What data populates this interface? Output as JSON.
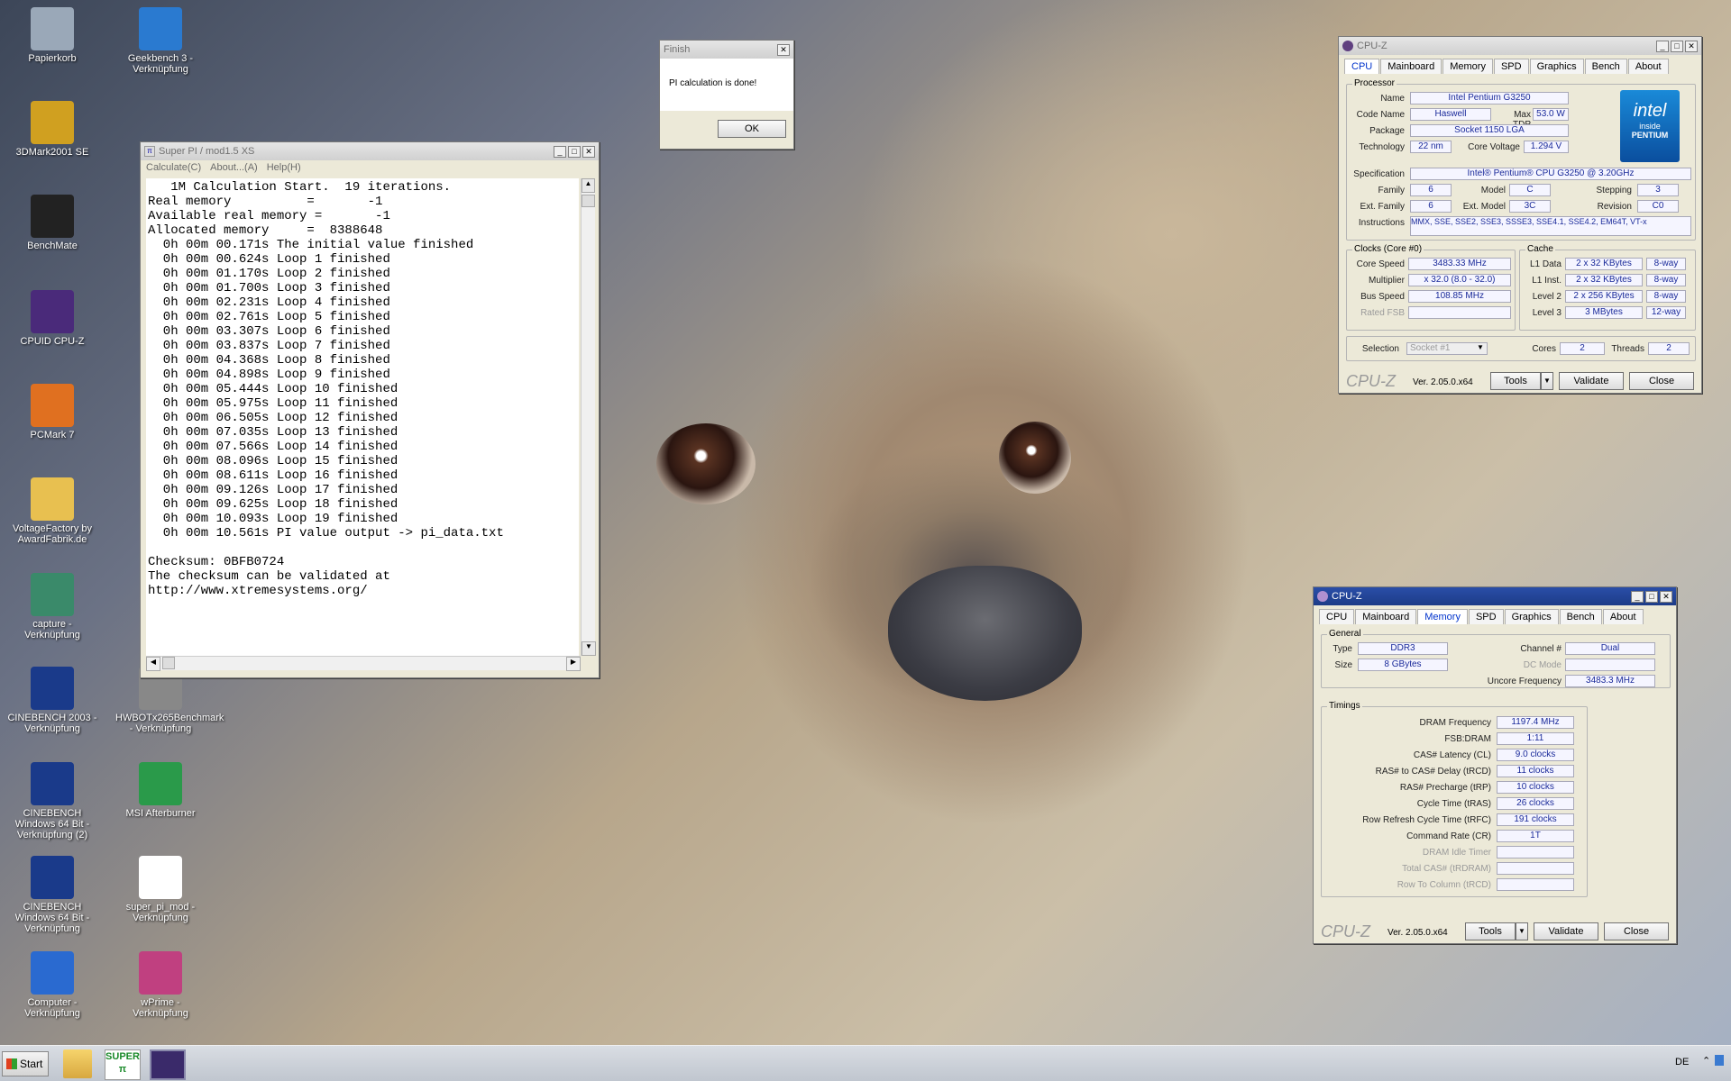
{
  "desktop_icons": [
    {
      "label": "Papierkorb",
      "icon": "recycle-bin-icon"
    },
    {
      "label": "Geekbench 3 - Verknüpfung",
      "icon": "geekbench-icon"
    },
    {
      "label": "3DMark2001 SE",
      "icon": "3dmark-icon"
    },
    {
      "label": "BenchMate",
      "icon": "benchmate-icon"
    },
    {
      "label": "CPUID CPU-Z",
      "icon": "cpuz-icon"
    },
    {
      "label": "PCMark 7",
      "icon": "pcmark-icon"
    },
    {
      "label": "VoltageFactory by AwardFabrik.de",
      "icon": "folder-icon"
    },
    {
      "label": "capture - Verknüpfung",
      "icon": "capture-icon"
    },
    {
      "label": "CINEBENCH 2003 - Verknüpfung",
      "icon": "cinebench-icon"
    },
    {
      "label": "HWBOTx265Benchmark - Verknüpfung",
      "icon": "hwbot-icon"
    },
    {
      "label": "CINEBENCH Windows 64 Bit - Verknüpfung (2)",
      "icon": "cinebench-icon"
    },
    {
      "label": "MSI Afterburner",
      "icon": "afterburner-icon"
    },
    {
      "label": "CINEBENCH Windows 64 Bit - Verknüpfung",
      "icon": "cinebench-icon"
    },
    {
      "label": "super_pi_mod - Verknüpfung",
      "icon": "superpi-icon"
    },
    {
      "label": "Computer - Verknüpfung",
      "icon": "computer-icon"
    },
    {
      "label": "wPrime - Verknüpfung",
      "icon": "wprime-icon"
    }
  ],
  "superpi": {
    "title": "Super PI / mod1.5 XS",
    "menu": [
      "Calculate(C)",
      "About...(A)",
      "Help(H)"
    ],
    "lines": [
      "   1M Calculation Start.  19 iterations.",
      "Real memory          =       -1",
      "Available real memory =       -1",
      "Allocated memory     =  8388648",
      "  0h 00m 00.171s The initial value finished",
      "  0h 00m 00.624s Loop 1 finished",
      "  0h 00m 01.170s Loop 2 finished",
      "  0h 00m 01.700s Loop 3 finished",
      "  0h 00m 02.231s Loop 4 finished",
      "  0h 00m 02.761s Loop 5 finished",
      "  0h 00m 03.307s Loop 6 finished",
      "  0h 00m 03.837s Loop 7 finished",
      "  0h 00m 04.368s Loop 8 finished",
      "  0h 00m 04.898s Loop 9 finished",
      "  0h 00m 05.444s Loop 10 finished",
      "  0h 00m 05.975s Loop 11 finished",
      "  0h 00m 06.505s Loop 12 finished",
      "  0h 00m 07.035s Loop 13 finished",
      "  0h 00m 07.566s Loop 14 finished",
      "  0h 00m 08.096s Loop 15 finished",
      "  0h 00m 08.611s Loop 16 finished",
      "  0h 00m 09.126s Loop 17 finished",
      "  0h 00m 09.625s Loop 18 finished",
      "  0h 00m 10.093s Loop 19 finished",
      "  0h 00m 10.561s PI value output -> pi_data.txt",
      "",
      "Checksum: 0BFB0724",
      "The checksum can be validated at",
      "http://www.xtremesystems.org/"
    ]
  },
  "finish_dialog": {
    "title": "Finish",
    "message": "PI calculation is done!",
    "ok": "OK"
  },
  "cpuz_tabs": [
    "CPU",
    "Mainboard",
    "Memory",
    "SPD",
    "Graphics",
    "Bench",
    "About"
  ],
  "cpuz_cpu": {
    "title": "CPU-Z",
    "processor_legend": "Processor",
    "name_label": "Name",
    "name": "Intel Pentium G3250",
    "codename_label": "Code Name",
    "codename": "Haswell",
    "maxtdp_label": "Max TDP",
    "maxtdp": "53.0 W",
    "package_label": "Package",
    "package": "Socket 1150 LGA",
    "technology_label": "Technology",
    "technology": "22 nm",
    "corevoltage_label": "Core Voltage",
    "corevoltage": "1.294 V",
    "spec_label": "Specification",
    "spec": "Intel® Pentium® CPU G3250 @ 3.20GHz",
    "family_label": "Family",
    "family": "6",
    "model_label": "Model",
    "model": "C",
    "stepping_label": "Stepping",
    "stepping": "3",
    "extfamily_label": "Ext. Family",
    "extfamily": "6",
    "extmodel_label": "Ext. Model",
    "extmodel": "3C",
    "revision_label": "Revision",
    "revision": "C0",
    "instructions_label": "Instructions",
    "instructions": "MMX, SSE, SSE2, SSE3, SSSE3, SSE4.1, SSE4.2, EM64T, VT-x",
    "clocks_legend": "Clocks (Core #0)",
    "corespeed_label": "Core Speed",
    "corespeed": "3483.33 MHz",
    "multiplier_label": "Multiplier",
    "multiplier": "x 32.0 (8.0 - 32.0)",
    "busspeed_label": "Bus Speed",
    "busspeed": "108.85 MHz",
    "ratedfsb_label": "Rated FSB",
    "ratedfsb": "",
    "cache_legend": "Cache",
    "l1data_label": "L1 Data",
    "l1data": "2 x 32 KBytes",
    "l1data_way": "8-way",
    "l1inst_label": "L1 Inst.",
    "l1inst": "2 x 32 KBytes",
    "l1inst_way": "8-way",
    "level2_label": "Level 2",
    "level2": "2 x 256 KBytes",
    "level2_way": "8-way",
    "level3_label": "Level 3",
    "level3": "3 MBytes",
    "level3_way": "12-way",
    "selection_label": "Selection",
    "selection": "Socket #1",
    "cores_label": "Cores",
    "cores": "2",
    "threads_label": "Threads",
    "threads": "2",
    "logo_top": "intel",
    "logo_mid": "inside",
    "logo_bottom": "PENTIUM"
  },
  "cpuz_mem": {
    "title": "CPU-Z",
    "general_legend": "General",
    "type_label": "Type",
    "type": "DDR3",
    "size_label": "Size",
    "size": "8 GBytes",
    "channel_label": "Channel #",
    "channel": "Dual",
    "dcmode_label": "DC Mode",
    "dcmode": "",
    "uncore_label": "Uncore Frequency",
    "uncore": "3483.3 MHz",
    "timings_legend": "Timings",
    "timings": [
      {
        "label": "DRAM Frequency",
        "value": "1197.4 MHz",
        "dim": false
      },
      {
        "label": "FSB:DRAM",
        "value": "1:11",
        "dim": false
      },
      {
        "label": "CAS# Latency (CL)",
        "value": "9.0 clocks",
        "dim": false
      },
      {
        "label": "RAS# to CAS# Delay (tRCD)",
        "value": "11 clocks",
        "dim": false
      },
      {
        "label": "RAS# Precharge (tRP)",
        "value": "10 clocks",
        "dim": false
      },
      {
        "label": "Cycle Time (tRAS)",
        "value": "26 clocks",
        "dim": false
      },
      {
        "label": "Row Refresh Cycle Time (tRFC)",
        "value": "191 clocks",
        "dim": false
      },
      {
        "label": "Command Rate (CR)",
        "value": "1T",
        "dim": false
      },
      {
        "label": "DRAM Idle Timer",
        "value": "",
        "dim": true
      },
      {
        "label": "Total CAS# (tRDRAM)",
        "value": "",
        "dim": true
      },
      {
        "label": "Row To Column (tRCD)",
        "value": "",
        "dim": true
      }
    ]
  },
  "cpuz_footer": {
    "brand": "CPU-Z",
    "version": "Ver. 2.05.0.x64",
    "tools": "Tools",
    "validate": "Validate",
    "close": "Close"
  },
  "taskbar": {
    "start": "Start",
    "language": "DE"
  }
}
